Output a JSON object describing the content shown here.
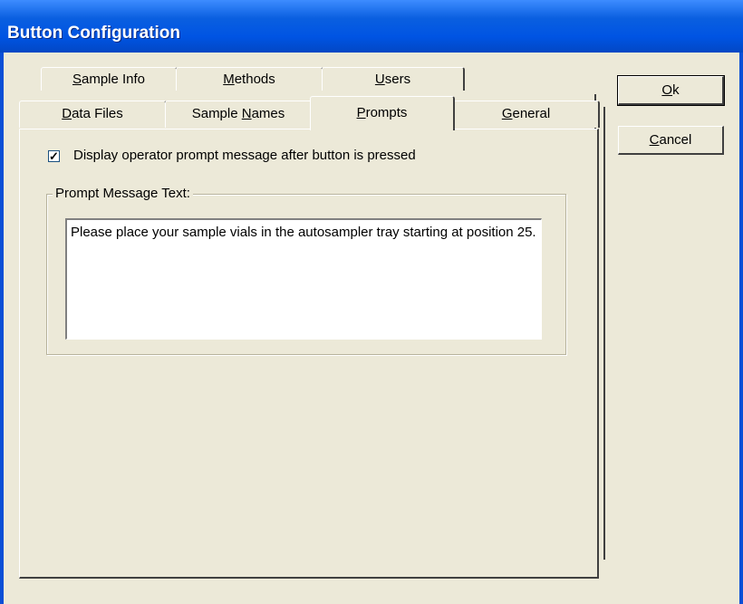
{
  "window": {
    "title": "Button Configuration"
  },
  "tabs": {
    "row_back": [
      {
        "label": "Sample Info",
        "mnemonic": "S"
      },
      {
        "label": "Methods",
        "mnemonic": "M"
      },
      {
        "label": "Users",
        "mnemonic": "U"
      }
    ],
    "row_front": [
      {
        "label": "Data Files",
        "mnemonic": "D"
      },
      {
        "label": "Sample Names",
        "mnemonic": "N"
      },
      {
        "label": "Prompts",
        "mnemonic": "P",
        "selected": true
      },
      {
        "label": "General",
        "mnemonic": "G"
      }
    ]
  },
  "prompts": {
    "display_prompt_checkbox": {
      "label": "Display operator prompt message after button is pressed",
      "checked": true
    },
    "group_label": "Prompt Message Text:",
    "message_text": "Please place your sample vials in the autosampler tray starting at position 25."
  },
  "buttons": {
    "ok": {
      "label": "Ok",
      "mnemonic": "O"
    },
    "cancel": {
      "label": "Cancel",
      "mnemonic": "C"
    }
  },
  "colors": {
    "titlebar": "#0054e3",
    "dialog_bg": "#ece9d8"
  }
}
